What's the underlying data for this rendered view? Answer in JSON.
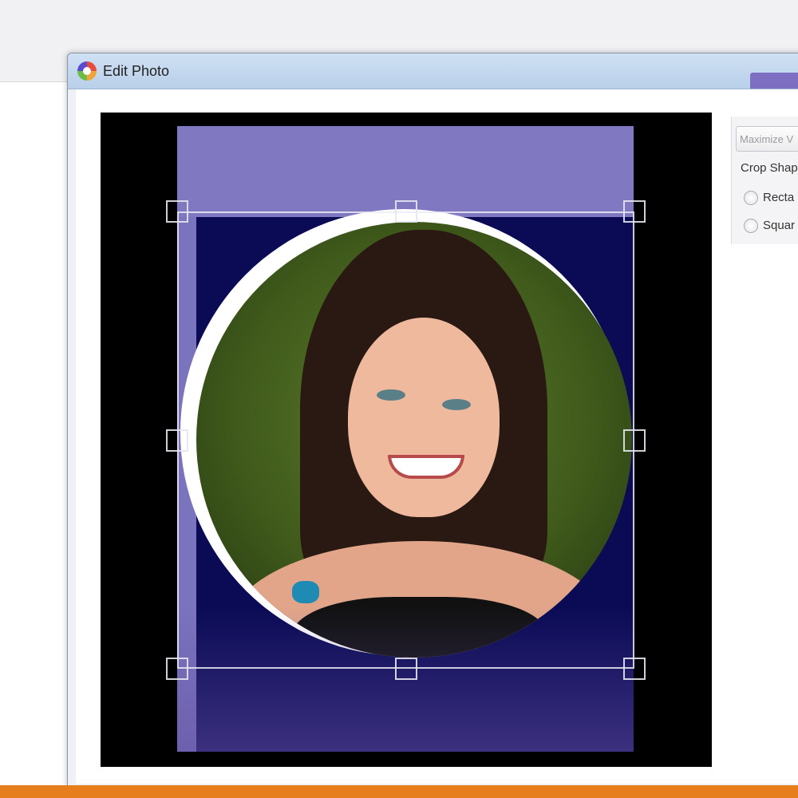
{
  "dialog": {
    "title": "Edit Photo"
  },
  "side_panel": {
    "maximize_label": "Maximize V",
    "crop_shape_label": "Crop Shap",
    "options": [
      {
        "label": "Recta"
      },
      {
        "label": "Squar"
      }
    ]
  },
  "colors": {
    "accent_orange": "#e67e1e",
    "overlay_lilac": "#8079c2",
    "crop_dark": "#0a0a55"
  }
}
